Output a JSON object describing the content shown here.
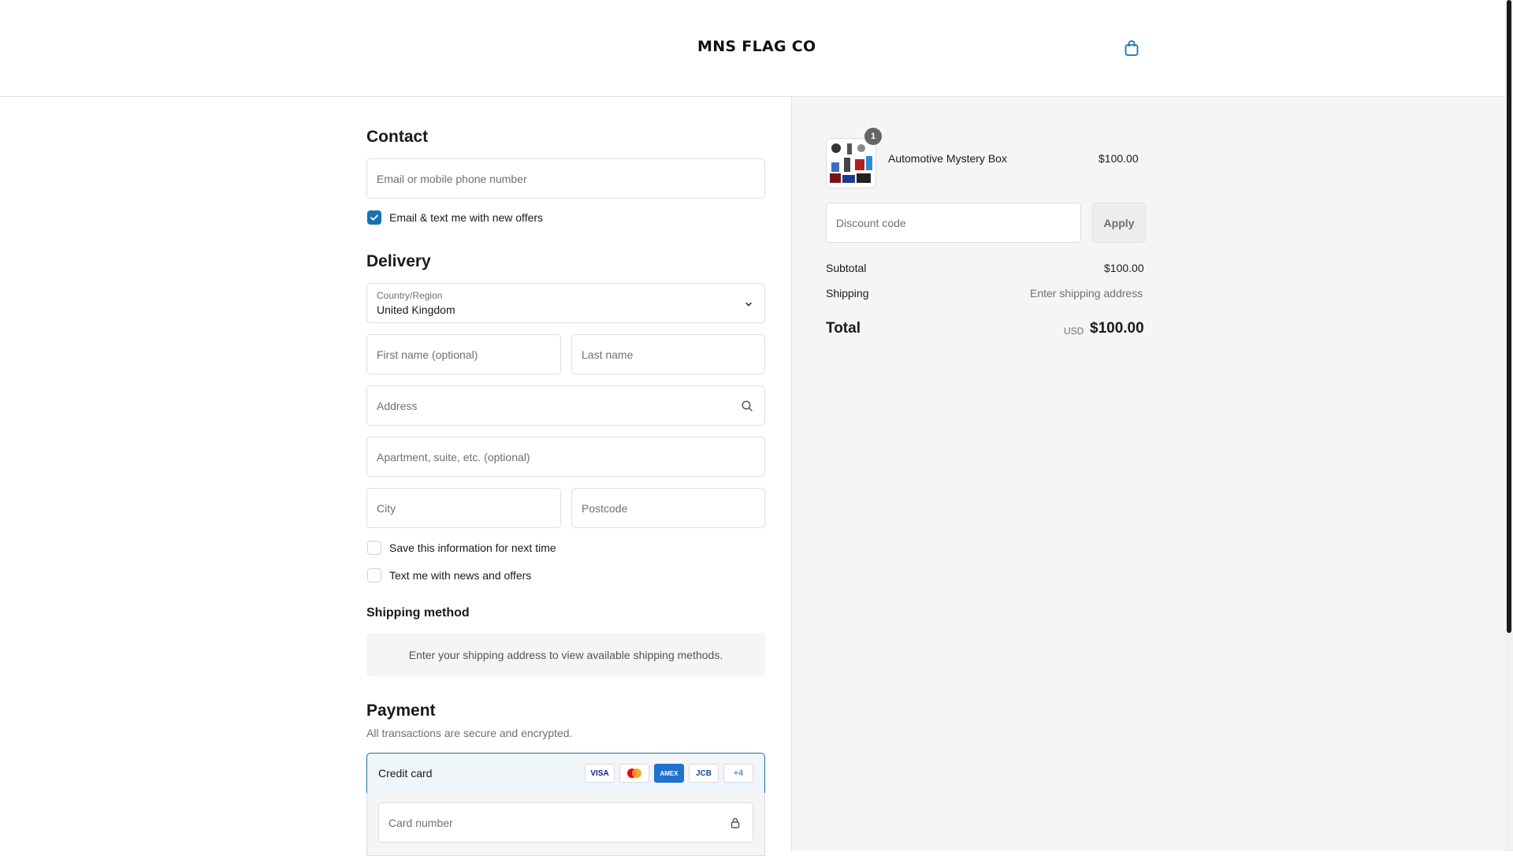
{
  "header": {
    "logo_text": "MNS FLAG CO",
    "cart_icon": "shopping-bag-icon"
  },
  "contact": {
    "title": "Contact",
    "email_placeholder": "Email or mobile phone number",
    "email_value": "",
    "offers_label": "Email & text me with new offers",
    "offers_checked": true
  },
  "delivery": {
    "title": "Delivery",
    "country_label": "Country/Region",
    "country_value": "United Kingdom",
    "first_name_placeholder": "First name (optional)",
    "last_name_placeholder": "Last name",
    "address_placeholder": "Address",
    "apartment_placeholder": "Apartment, suite, etc. (optional)",
    "city_placeholder": "City",
    "postcode_placeholder": "Postcode",
    "save_info_label": "Save this information for next time",
    "text_news_label": "Text me with news and offers"
  },
  "shipping_method": {
    "title": "Shipping method",
    "message": "Enter your shipping address to view available shipping methods."
  },
  "payment": {
    "title": "Payment",
    "subtitle": "All transactions are secure and encrypted.",
    "credit_card_label": "Credit card",
    "card_brands": [
      "VISA",
      "",
      "AMEX",
      "JCB",
      "+4"
    ],
    "card_number_placeholder": "Card number"
  },
  "summary": {
    "item_name": "Automotive Mystery Box",
    "item_price": "$100.00",
    "item_qty": "1",
    "discount_placeholder": "Discount code",
    "apply_label": "Apply",
    "subtotal_label": "Subtotal",
    "subtotal_value": "$100.00",
    "shipping_label": "Shipping",
    "shipping_value": "Enter shipping address",
    "total_label": "Total",
    "currency": "USD",
    "total_value": "$100.00"
  },
  "colors": {
    "accent": "#1773b0",
    "summary_bg": "#f5f5f5",
    "border": "#dedede"
  }
}
